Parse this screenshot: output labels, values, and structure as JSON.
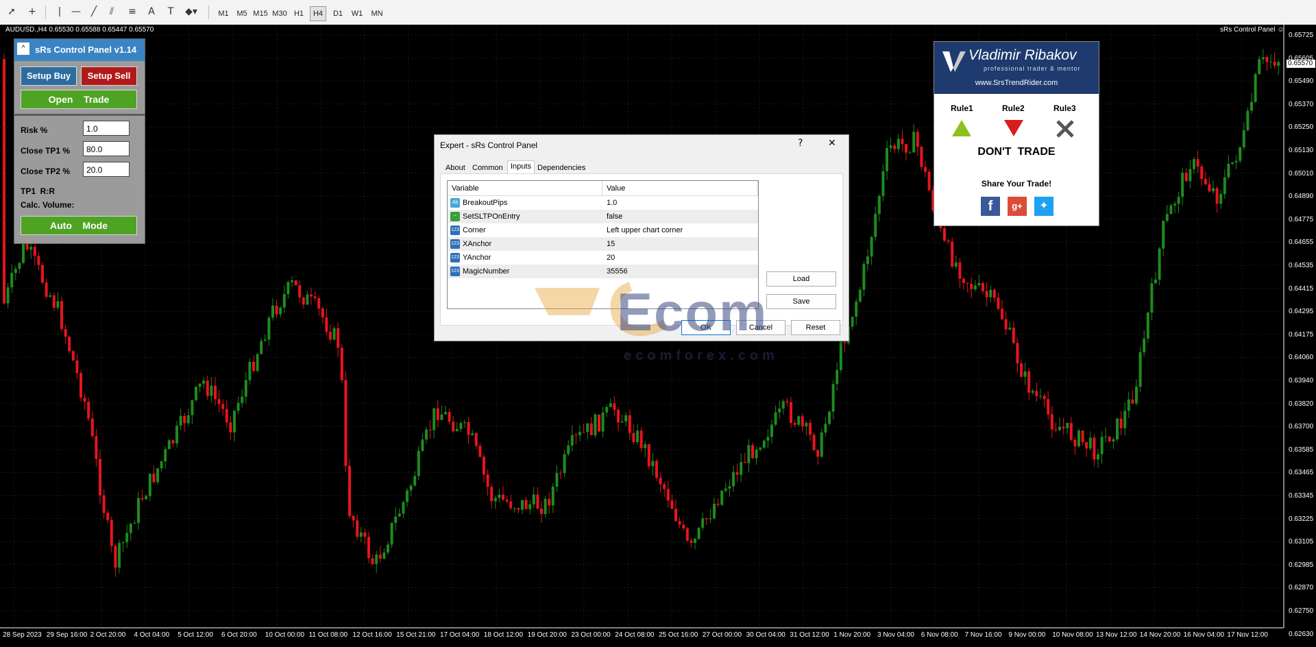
{
  "toolbar": {
    "tools": [
      "cursor-icon",
      "crosshair-icon",
      "vertical-line-icon",
      "horizontal-line-icon",
      "trendline-icon",
      "channel-icon",
      "fibonacci-icon",
      "text-icon",
      "text-label-icon",
      "shapes-icon"
    ],
    "timeframes": [
      "M1",
      "M5",
      "M15",
      "M30",
      "H1",
      "H4",
      "D1",
      "W1",
      "MN"
    ],
    "active_timeframe": "H4"
  },
  "chart": {
    "symbol_info": "AUDUSD.,H4  0.65530 0.65588 0.65447 0.65570",
    "ea_label": "sRs Control Panel",
    "ea_icon": "smiley-icon",
    "current_price": "0.65570",
    "price_labels": [
      "0.65725",
      "0.65605",
      "0.65490",
      "0.65370",
      "0.65250",
      "0.65130",
      "0.65010",
      "0.64890",
      "0.64775",
      "0.64655",
      "0.64535",
      "0.64415",
      "0.64295",
      "0.64175",
      "0.64060",
      "0.63940",
      "0.63820",
      "0.63700",
      "0.63585",
      "0.63465",
      "0.63345",
      "0.63225",
      "0.63105",
      "0.62985",
      "0.62870",
      "0.62750",
      "0.62630"
    ],
    "date_labels": [
      "28 Sep 2023",
      "29 Sep 16:00",
      "2 Oct 20:00",
      "4 Oct 04:00",
      "5 Oct 12:00",
      "6 Oct 20:00",
      "10 Oct 00:00",
      "11 Oct 08:00",
      "12 Oct 16:00",
      "15 Oct 21:00",
      "17 Oct 04:00",
      "18 Oct 12:00",
      "19 Oct 20:00",
      "23 Oct 00:00",
      "24 Oct 08:00",
      "25 Oct 16:00",
      "27 Oct 00:00",
      "30 Oct 04:00",
      "31 Oct 12:00",
      "1 Nov 20:00",
      "3 Nov 04:00",
      "6 Nov 08:00",
      "7 Nov 16:00",
      "9 Nov 00:00",
      "10 Nov 08:00",
      "13 Nov 12:00",
      "14 Nov 20:00",
      "16 Nov 04:00",
      "17 Nov 12:00"
    ],
    "up_color": "#1e8c1e",
    "down_color": "#e8141e"
  },
  "control_panel": {
    "title": "sRs Control Panel v1.14",
    "minimize": "^",
    "setup_buy": "Setup Buy",
    "setup_sell": "Setup Sell",
    "open_trade": "Open    Trade",
    "risk_label": "Risk %",
    "risk_value": "1.0",
    "tp1_label": "Close TP1 %",
    "tp1_value": "80.0",
    "tp2_label": "Close TP2 %",
    "tp2_value": "20.0",
    "rr_label": "TP1  R:R",
    "volume_label": "Calc. Volume:",
    "auto_mode": "Auto    Mode"
  },
  "ribakov": {
    "name": "Vladimir Ribakov",
    "tagline": "professional trader & mentor",
    "url": "www.SrsTrendRider.com",
    "rules": [
      "Rule1",
      "Rule2",
      "Rule3"
    ],
    "status": "DON'T  TRADE",
    "share": "Share Your Trade!"
  },
  "dialog": {
    "title": "Expert - sRs Control Panel",
    "help": "?",
    "close": "✕",
    "tabs": [
      "About",
      "Common",
      "Inputs",
      "Dependencies"
    ],
    "active_tab": "Inputs",
    "col_variable": "Variable",
    "col_value": "Value",
    "rows": [
      {
        "icon": "Ab",
        "name": "BreakoutPips",
        "value": "1.0"
      },
      {
        "icon": "~",
        "name": "SetSLTPOnEntry",
        "value": "false"
      },
      {
        "icon": "123",
        "name": "Corner",
        "value": "Left upper chart corner"
      },
      {
        "icon": "123",
        "name": "XAnchor",
        "value": "15"
      },
      {
        "icon": "123",
        "name": "YAnchor",
        "value": "20"
      },
      {
        "icon": "123",
        "name": "MagicNumber",
        "value": "35556"
      }
    ],
    "load": "Load",
    "save": "Save",
    "ok": "OK",
    "cancel": "Cancel",
    "reset": "Reset"
  },
  "watermark": {
    "text": "Ecom",
    "url": "ecomforex.com"
  }
}
